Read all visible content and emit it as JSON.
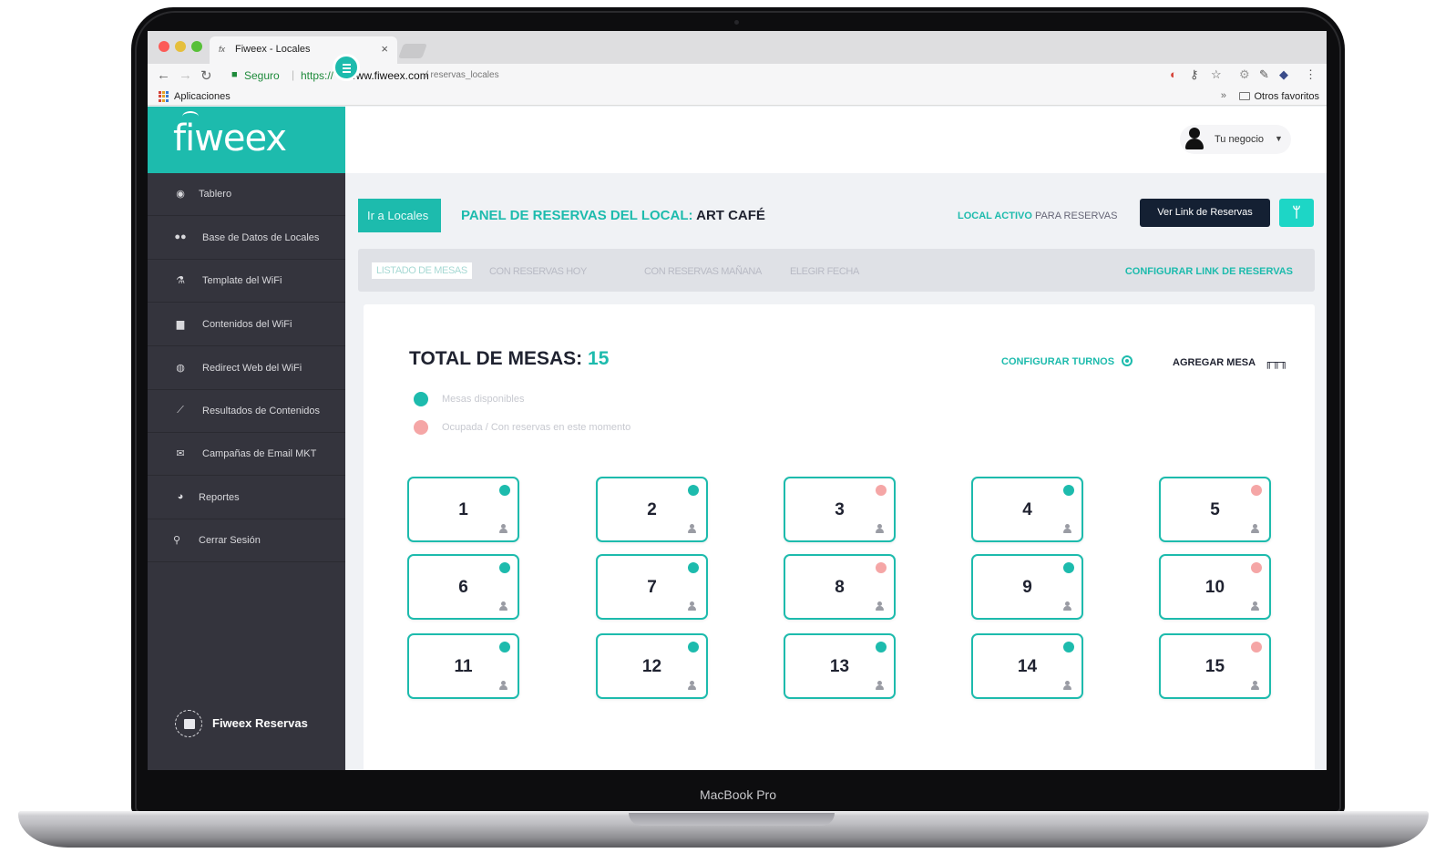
{
  "colors": {
    "accent": "#1dbbad",
    "available": "#1dbbad",
    "occupied": "#f5a6a6",
    "sidebar": "#34343d",
    "dark_button": "#142033"
  },
  "browser": {
    "tab_title": "Fiweex - Locales",
    "tab_favicon": "fx",
    "secure_label": "Seguro",
    "url_scheme": "https://",
    "url_host": "www.fiweex.com",
    "url_path": "/ reservas_locales",
    "bookmarks_apps": "Aplicaciones",
    "bookmarks_other": "Otros favoritos",
    "bookmarks_chevron": "»"
  },
  "device_label": "MacBook Pro",
  "sidebar": {
    "logo": "fiweex",
    "items": [
      {
        "label": "Tablero",
        "icon": "dashboard-icon"
      },
      {
        "label": "Base de Datos de Locales",
        "icon": "users-icon"
      },
      {
        "label": "Template del WiFi",
        "icon": "flask-icon"
      },
      {
        "label": "Contenidos del WiFi",
        "icon": "archive-icon"
      },
      {
        "label": "Redirect Web del WiFi",
        "icon": "globe-icon"
      },
      {
        "label": "Resultados de Contenidos",
        "icon": "line-chart-icon"
      },
      {
        "label": "Campañas de Email MKT",
        "icon": "envelope-icon"
      },
      {
        "label": "Reportes",
        "icon": "pie-chart-icon"
      },
      {
        "label": "Cerrar Sesión",
        "icon": "search-icon"
      }
    ],
    "footer": "Fiweex Reservas"
  },
  "topbar": {
    "user_label": "Tu negocio"
  },
  "header": {
    "back_button": "Ir a Locales",
    "panel_title": "PANEL DE RESERVAS DEL LOCAL:",
    "local_name": "ART CAFÉ",
    "local_status_strong": "LOCAL ACTIVO",
    "local_status_rest": "PARA RESERVAS",
    "link_button": "Ver Link de Reservas"
  },
  "tabs": {
    "items": [
      "LISTADO DE MESAS",
      "CON RESERVAS HOY",
      "CON RESERVAS MAÑANA",
      "ELEGIR FECHA"
    ],
    "active": "LISTADO DE MESAS",
    "config_link": "CONFIGURAR LINK DE RESERVAS"
  },
  "main": {
    "total_label": "TOTAL DE MESAS:",
    "total_value": "15",
    "config_turnos": "CONFIGURAR TURNOS",
    "add_table": "AGREGAR MESA",
    "legend": [
      {
        "label": "Mesas disponibles",
        "status": "available"
      },
      {
        "label": "Ocupada / Con reservas en este momento",
        "status": "occupied"
      }
    ],
    "tables": [
      {
        "number": "1",
        "status": "available"
      },
      {
        "number": "2",
        "status": "available"
      },
      {
        "number": "3",
        "status": "occupied"
      },
      {
        "number": "4",
        "status": "available"
      },
      {
        "number": "5",
        "status": "occupied"
      },
      {
        "number": "6",
        "status": "available"
      },
      {
        "number": "7",
        "status": "available"
      },
      {
        "number": "8",
        "status": "occupied"
      },
      {
        "number": "9",
        "status": "available"
      },
      {
        "number": "10",
        "status": "occupied"
      },
      {
        "number": "11",
        "status": "available"
      },
      {
        "number": "12",
        "status": "available"
      },
      {
        "number": "13",
        "status": "available"
      },
      {
        "number": "14",
        "status": "available"
      },
      {
        "number": "15",
        "status": "occupied"
      }
    ]
  }
}
